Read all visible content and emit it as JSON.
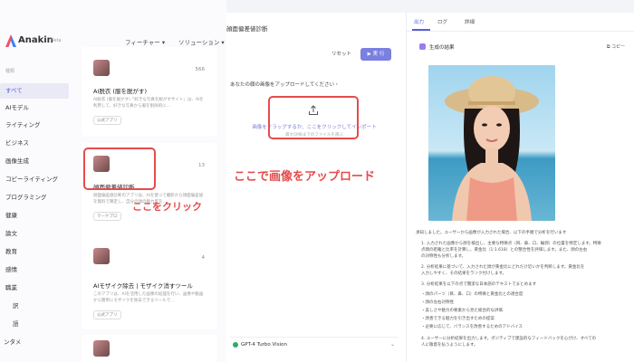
{
  "app": {
    "name": "Anakin",
    "badge": "Beta"
  },
  "nav": {
    "features": "フィーチャー ▾",
    "solutions": "ソリューション ▾"
  },
  "sidebar": {
    "heading": "種類",
    "items": [
      "すべて",
      "AIモデル",
      "ライティング",
      "ビジネス",
      "画像生成",
      "コピーライティング",
      "プログラミング",
      "健康",
      "論文",
      "教育",
      "感情",
      "職業",
      "訳",
      "語",
      "ンタメ"
    ]
  },
  "feed": {
    "cards": [
      {
        "title": "AI脱衣 (服を脱がす)",
        "count": "566",
        "desc": "AI脱衣 (服を脱がす)「好きな写真を脱がすサイト」は、AIを利用して、好きな写真から服を削除的に…",
        "tag": "公式アプリ"
      },
      {
        "title": "顔面偏差値診断",
        "count": "13",
        "desc": "顔面偏差値診断のアプリは、AIを使って撮影から顔面偏差値を無料で算定し、自分の顔の魅力度を…",
        "tag": "マーケプロ"
      },
      {
        "title": "AIモザイク除去 | モザイク消すツール",
        "count": "4",
        "desc": "このアプリは、AIを活用した画像の処理を行い、画像や動画から簡単にモザイクを除去できるツールで…",
        "tag": "公式アプリ"
      }
    ]
  },
  "annotations": {
    "click": "ここをクリック",
    "upload": "ここで画像をアップロード"
  },
  "middle": {
    "title": "顔面偏差値診断",
    "reset": "リセット",
    "run": "▶ 実 行",
    "upload_label": "あなたの顔の画像をアップロードしてください・",
    "upload_hint": "画像をドラッグするか、ここをクリックしてインポート",
    "upload_sub": "最大5MBまでのファイルを選ぶ",
    "model": "GPT-4 Turbo Vision"
  },
  "result": {
    "tabs": [
      "出力",
      "ログ",
      "詳細"
    ],
    "title": "生成の結果",
    "copy": "コピー",
    "lines": [
      "承知しました。ユーザーから画像が入力された場合、以下の手順で分析を行います",
      "1. 入力された画像から顔を検出し、主要な特徴点（目、鼻、口、輪郭）の位置を特定します。特徴",
      "   点間の距離と比率を計算し、黄金比（1:1.618）との整合性を評価します。また、顔の左右",
      "   の対称性も分析します。",
      "2. 分析結果に基づいて、入力された顔が黄金比にどれだけ近いかを判断します。黄金比を",
      "   入力しやすく、その結果をランク付けします。",
      "3. 分析結果を以下の点で簡潔な日本語のテキストでまとめます",
      "   ・顔のパーツ（目、鼻、口）の特徴と黄金比との適合度",
      "   ・顔の左右対称性",
      "   ・美しさや魅力の要素から見た総合的な評価",
      "   ・改善できる魅力を引き出すための提案",
      "   ・必要に応じて、バランスを改善するためのアドバイス",
      "4. ユーザーに分析結果を出力します。ポジティブで建設的なフィードバックを心がけ、すべての",
      "   人に敬意を払うようにします。"
    ]
  }
}
